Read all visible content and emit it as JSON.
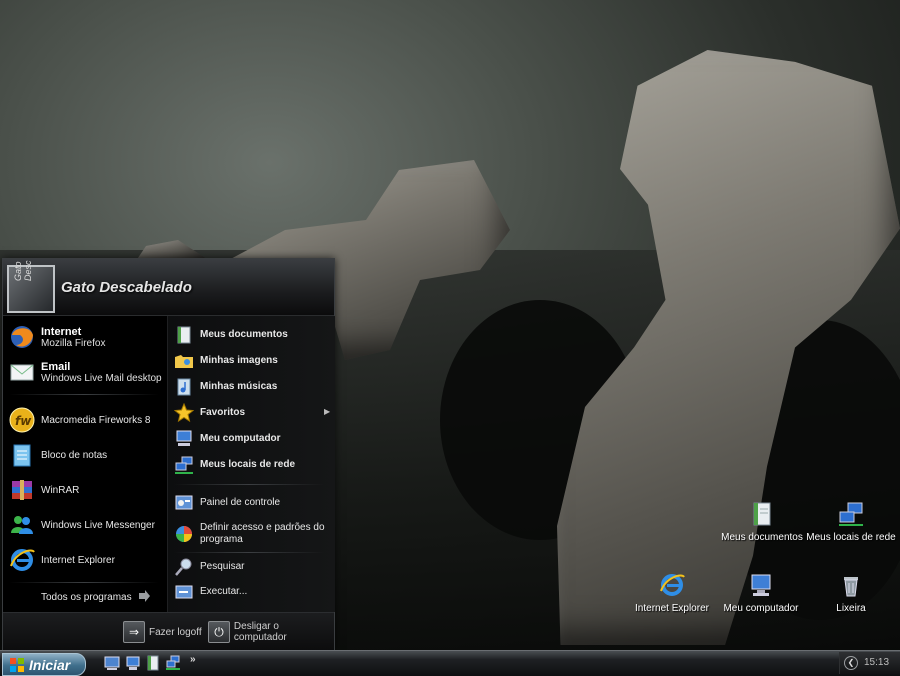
{
  "start_menu": {
    "username": "Gato Descabelado",
    "avatar_text": "Gato Desc",
    "pinned": [
      {
        "title": "Internet",
        "subtitle": "Mozilla Firefox",
        "icon": "firefox-icon"
      },
      {
        "title": "Email",
        "subtitle": "Windows Live Mail desktop",
        "icon": "mail-icon"
      }
    ],
    "recent": [
      {
        "label": "Macromedia Fireworks 8",
        "icon": "fireworks-icon"
      },
      {
        "label": "Bloco de notas",
        "icon": "notepad-icon"
      },
      {
        "label": "WinRAR",
        "icon": "winrar-icon"
      },
      {
        "label": "Windows Live Messenger",
        "icon": "messenger-icon"
      },
      {
        "label": "Internet Explorer",
        "icon": "ie-icon"
      }
    ],
    "all_programs": "Todos os programas",
    "places": [
      {
        "label": "Meus documentos",
        "icon": "documents-icon"
      },
      {
        "label": "Minhas imagens",
        "icon": "pictures-icon"
      },
      {
        "label": "Minhas músicas",
        "icon": "music-icon"
      },
      {
        "label": "Favoritos",
        "icon": "favorites-star-icon"
      },
      {
        "label": "Meu computador",
        "icon": "computer-icon"
      },
      {
        "label": "Meus locais de rede",
        "icon": "network-icon"
      }
    ],
    "system": [
      {
        "label": "Painel de controle",
        "icon": "control-panel-icon"
      },
      {
        "label": "Definir acesso e padrões do programa",
        "icon": "program-defaults-icon"
      }
    ],
    "tools": [
      {
        "label": "Pesquisar",
        "icon": "search-icon"
      },
      {
        "label": "Executar...",
        "icon": "run-icon"
      }
    ],
    "footer": {
      "logoff": "Fazer logoff",
      "shutdown": "Desligar o computador"
    }
  },
  "desktop_icons": [
    {
      "label": "Meus documentos",
      "icon": "documents-icon"
    },
    {
      "label": "Meus locais de rede",
      "icon": "network-icon"
    },
    {
      "label": "Internet Explorer",
      "icon": "ie-icon"
    },
    {
      "label": "Meu computador",
      "icon": "computer-icon"
    },
    {
      "label": "Lixeira",
      "icon": "recycle-bin-icon"
    }
  ],
  "taskbar": {
    "start_label": "Iniciar",
    "quick_launch": [
      "show-desktop-icon",
      "computer-icon",
      "documents-icon",
      "network-icon"
    ],
    "overflow": "»",
    "clock": "15:13"
  }
}
